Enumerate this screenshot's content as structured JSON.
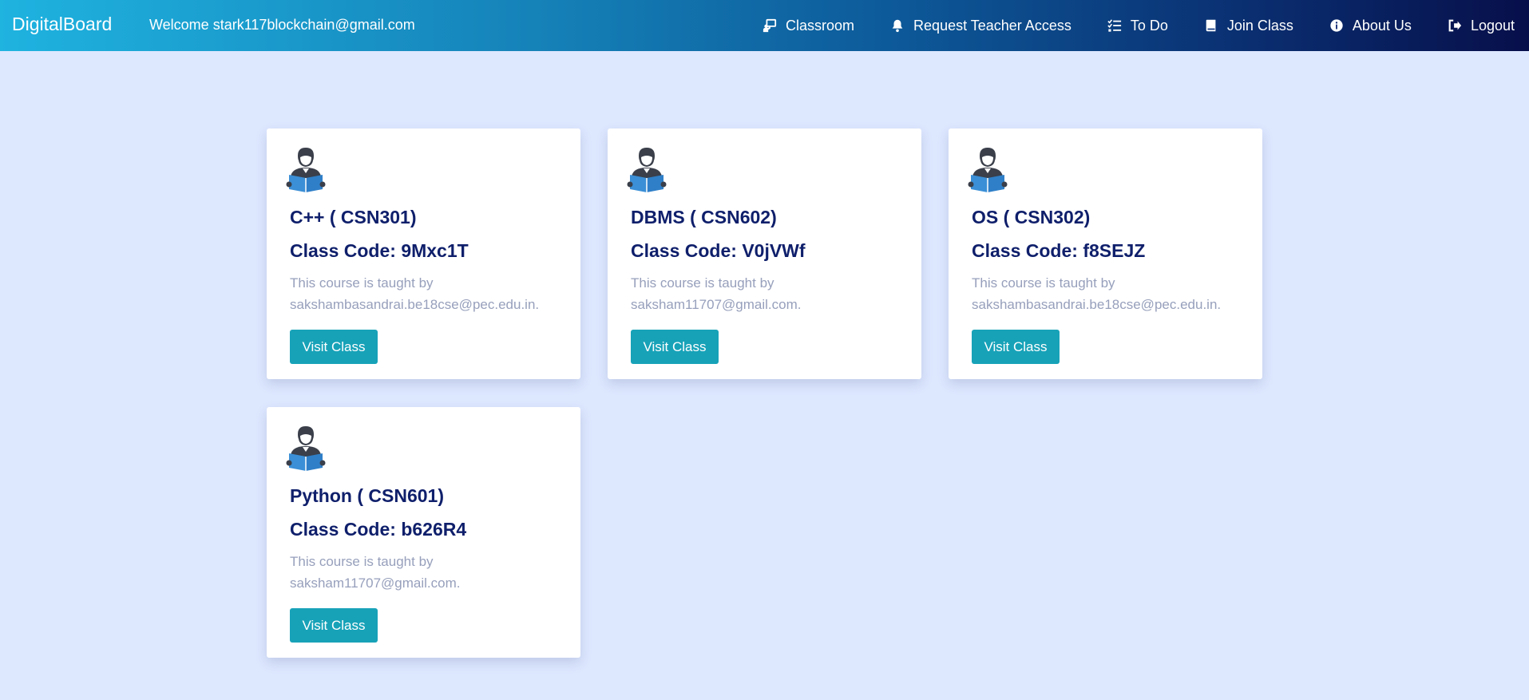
{
  "header": {
    "brand": "DigitalBoard",
    "welcome": "Welcome stark117blockchain@gmail.com",
    "nav": [
      {
        "label": "Classroom",
        "icon": "classroom-icon"
      },
      {
        "label": "Request Teacher Access",
        "icon": "bell-icon"
      },
      {
        "label": "To Do",
        "icon": "checklist-icon"
      },
      {
        "label": "Join Class",
        "icon": "book-icon"
      },
      {
        "label": "About Us",
        "icon": "info-icon"
      },
      {
        "label": "Logout",
        "icon": "logout-icon"
      }
    ]
  },
  "classes": [
    {
      "title": "C++ ( CSN301)",
      "code": "Class Code: 9Mxc1T",
      "desc": "This course is taught by sakshambasandrai.be18cse@pec.edu.in.",
      "button": "Visit Class"
    },
    {
      "title": "DBMS ( CSN602)",
      "code": "Class Code: V0jVWf",
      "desc": "This course is taught by saksham11707@gmail.com.",
      "button": "Visit Class"
    },
    {
      "title": "OS ( CSN302)",
      "code": "Class Code: f8SEJZ",
      "desc": "This course is taught by sakshambasandrai.be18cse@pec.edu.in.",
      "button": "Visit Class"
    },
    {
      "title": "Python ( CSN601)",
      "code": "Class Code: b626R4",
      "desc": "This course is taught by saksham11707@gmail.com.",
      "button": "Visit Class"
    }
  ],
  "colors": {
    "page_bg": "#dde7fe",
    "title_text": "#0f1f6b",
    "button_bg": "#17a2b8",
    "desc_text": "#97a0bc"
  }
}
